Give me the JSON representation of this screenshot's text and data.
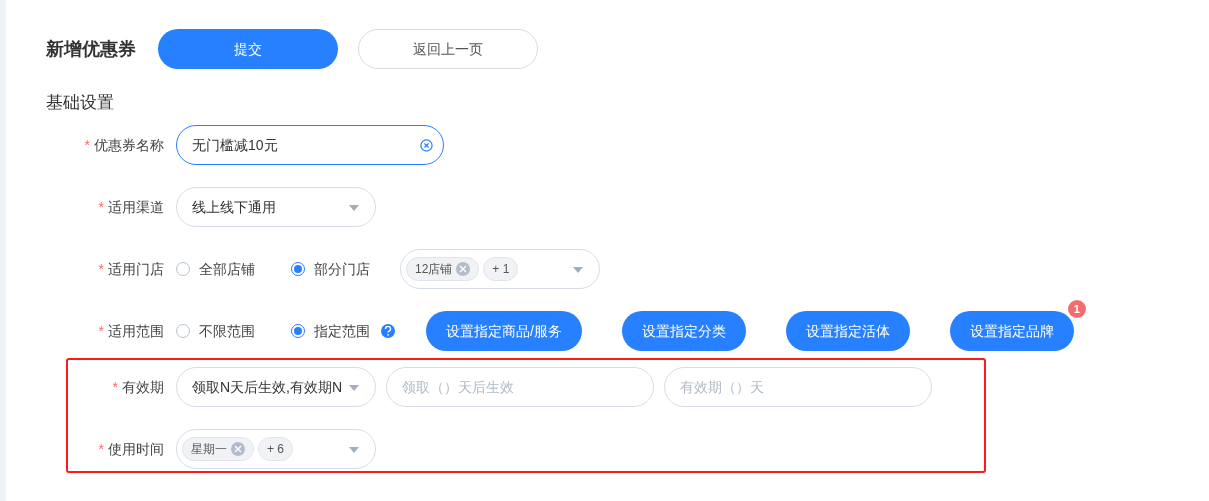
{
  "title": "新增优惠券",
  "buttons": [
    {
      "label": "提交",
      "kind": "primary"
    },
    {
      "label": "返回上一页",
      "kind": "default"
    }
  ],
  "section_title": "基础设置",
  "fields": [
    {
      "kind": "input",
      "label": "优惠券名称",
      "marker": "*",
      "value": "无门槛减10元"
    },
    {
      "kind": "select",
      "label": "适用渠道",
      "marker": "*",
      "value": "线上线下通用"
    },
    {
      "kind": "radio_tags",
      "label": "适用门店",
      "marker": "*",
      "options": [
        {
          "label": "全部店铺",
          "selected": false
        },
        {
          "label": "部分门店",
          "selected": true
        }
      ],
      "tags": [
        {
          "text": "12店铺",
          "removable": true
        },
        {
          "text": "+ 1",
          "removable": false
        }
      ]
    },
    {
      "kind": "radio_buttons",
      "label": "适用范围",
      "marker": "*",
      "options": [
        {
          "label": "不限范围",
          "selected": false
        },
        {
          "label": "指定范围",
          "selected": true
        }
      ],
      "actions": [
        {
          "label": "设置指定商品/服务"
        },
        {
          "label": "设置指定分类"
        },
        {
          "label": "设置指定活体"
        },
        {
          "label": "设置指定品牌",
          "badge": "1"
        }
      ]
    }
  ],
  "highlighted_fields": [
    {
      "kind": "select_inputs",
      "label": "有效期",
      "marker": "*",
      "value": "领取N天后生效,有效期N",
      "inputs": [
        {
          "placeholder": "领取（）天后生效"
        },
        {
          "placeholder": "有效期（）天"
        }
      ]
    },
    {
      "kind": "tag_select",
      "label": "使用时间",
      "marker": "*",
      "tags": [
        {
          "text": "星期一",
          "removable": true
        },
        {
          "text": "+ 6",
          "removable": false
        }
      ]
    }
  ]
}
